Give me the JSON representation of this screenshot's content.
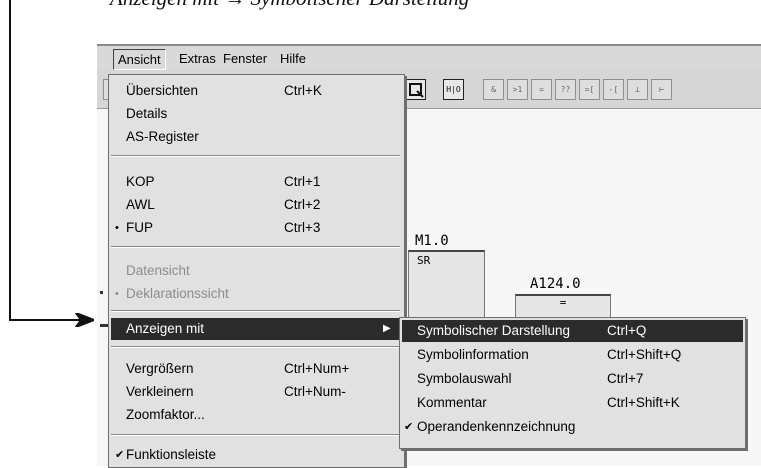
{
  "caption": "Anzeigen mit → Symbolischer Darstellung",
  "menubar": {
    "items": [
      "Ansicht",
      "Extras",
      "Fenster",
      "Hilfe"
    ]
  },
  "toolbar": {
    "buttons": [
      "H|O",
      "&",
      ">1",
      "=",
      "??",
      "=[",
      "-[",
      "⊥",
      "⊢"
    ]
  },
  "editor": {
    "block1_label": "M1.0",
    "block1_title": "SR",
    "block2_label": "A124.0",
    "block2_title": "="
  },
  "ansicht_menu": {
    "items": [
      {
        "label": "Übersichten",
        "shortcut": "Ctrl+K"
      },
      {
        "label": "Details",
        "shortcut": ""
      },
      {
        "label": "AS-Register",
        "shortcut": ""
      },
      {
        "label": "KOP",
        "shortcut": "Ctrl+1"
      },
      {
        "label": "AWL",
        "shortcut": "Ctrl+2"
      },
      {
        "label": "FUP",
        "shortcut": "Ctrl+3",
        "mark": "•"
      },
      {
        "label": "Datensicht",
        "shortcut": ""
      },
      {
        "label": "Deklarationssicht",
        "shortcut": "",
        "mark": "•"
      },
      {
        "label": "Anzeigen mit",
        "shortcut": "▶"
      },
      {
        "label": "Vergrößern",
        "shortcut": "Ctrl+Num+"
      },
      {
        "label": "Verkleinern",
        "shortcut": "Ctrl+Num-"
      },
      {
        "label": "Zoomfaktor...",
        "shortcut": ""
      },
      {
        "label": "Funktionsleiste",
        "shortcut": "",
        "mark": "✔"
      }
    ]
  },
  "anzeigen_submenu": {
    "items": [
      {
        "label": "Symbolischer Darstellung",
        "shortcut": "Ctrl+Q"
      },
      {
        "label": "Symbolinformation",
        "shortcut": "Ctrl+Shift+Q"
      },
      {
        "label": "Symbolauswahl",
        "shortcut": "Ctrl+7"
      },
      {
        "label": "Kommentar",
        "shortcut": "Ctrl+Shift+K"
      },
      {
        "label": "Operandenkennzeichnung",
        "shortcut": "",
        "mark": "✔"
      }
    ]
  }
}
